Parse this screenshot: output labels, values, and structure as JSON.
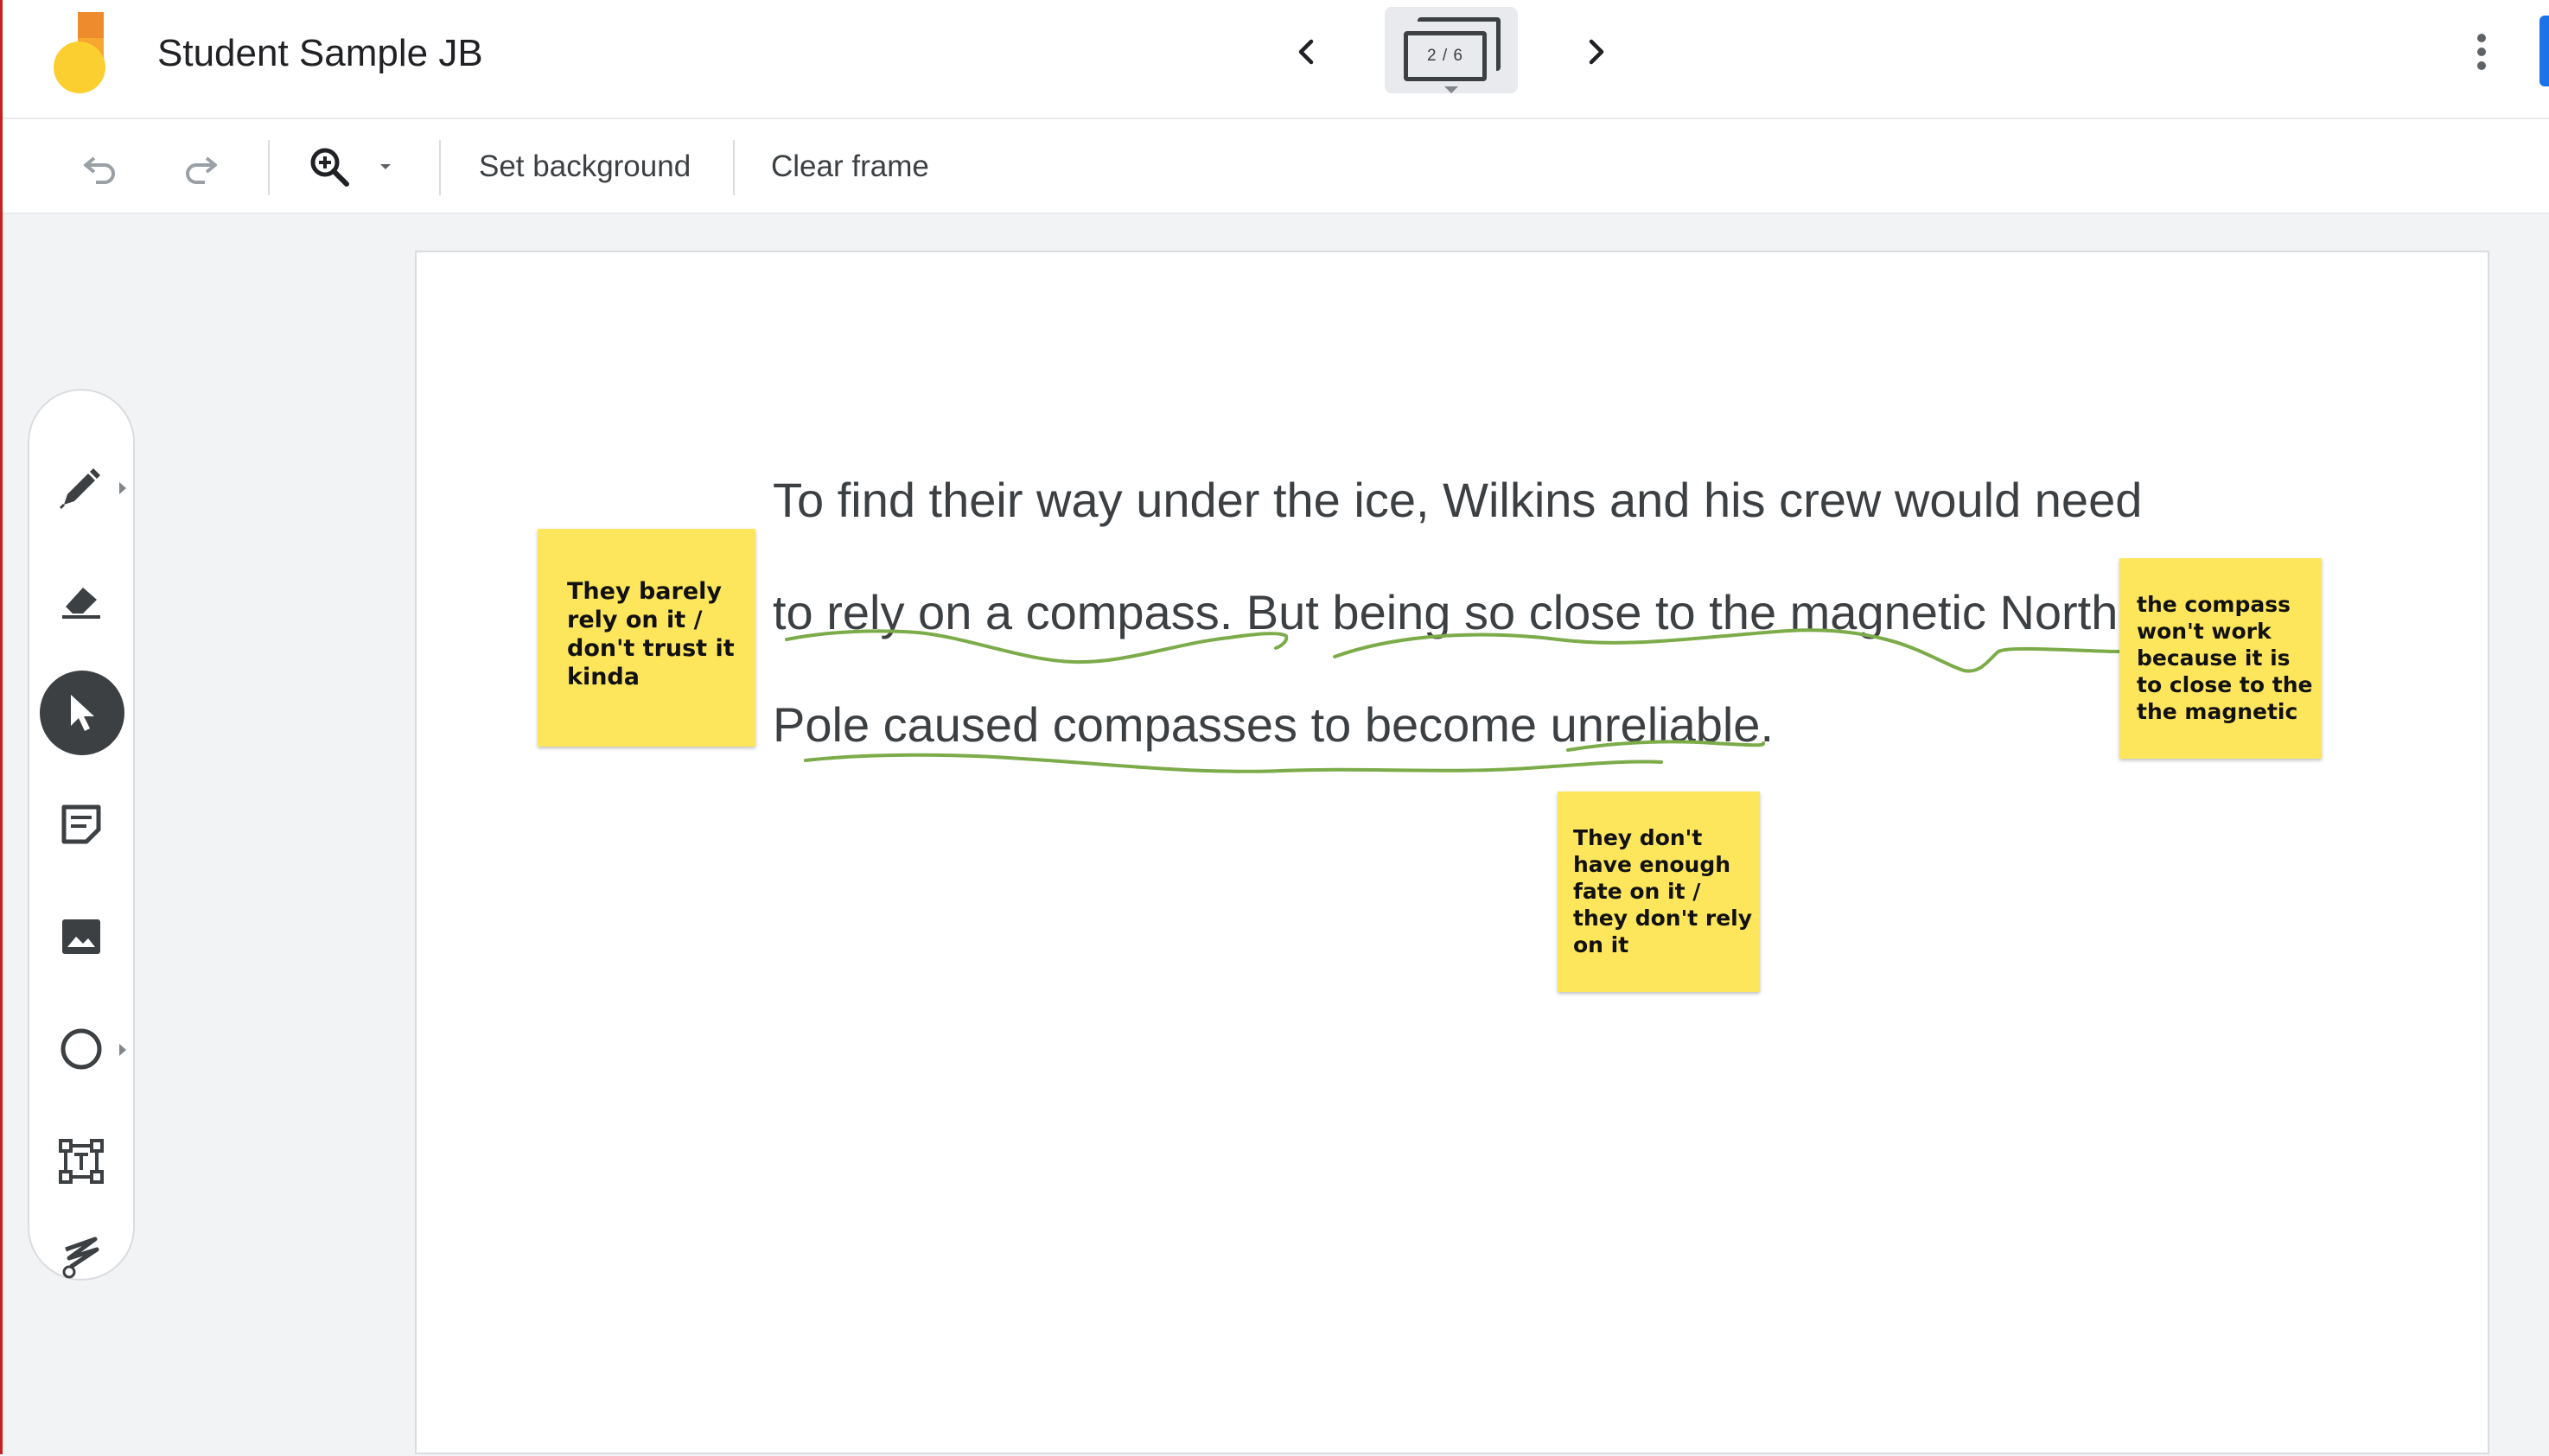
{
  "app": {
    "title": "Student Sample JB",
    "frame_counter": "2 / 6",
    "logo_icon": "jamboard-logo-icon",
    "accent_color": "#1a73e8"
  },
  "navigation": {
    "prev_icon": "chevron-left-icon",
    "next_icon": "chevron-right-icon",
    "more_icon": "more-vert-icon"
  },
  "toolbar": {
    "undo_icon": "undo-icon",
    "redo_icon": "redo-icon",
    "zoom_icon": "zoom-in-icon",
    "zoom_dropdown_icon": "arrow-drop-down-icon",
    "set_background_label": "Set background",
    "clear_frame_label": "Clear frame"
  },
  "tools": [
    {
      "name": "Pen",
      "icon": "pen-icon"
    },
    {
      "name": "Eraser",
      "icon": "eraser-icon"
    },
    {
      "name": "Select",
      "icon": "cursor-icon",
      "active": true
    },
    {
      "name": "Sticky note",
      "icon": "sticky-note-icon"
    },
    {
      "name": "Add image",
      "icon": "image-icon"
    },
    {
      "name": "Circle",
      "icon": "circle-icon"
    },
    {
      "name": "Text box",
      "icon": "text-box-icon"
    },
    {
      "name": "Laser",
      "icon": "laser-icon"
    }
  ],
  "canvas": {
    "text_lines": [
      "To find their way under the ice, Wilkins and his crew would need",
      "to rely on a compass. But being so close to the magnetic North",
      "Pole caused compasses to become unreliable."
    ],
    "ink_color": "#7cab4a",
    "sticky_color": "#fde65c",
    "sticky_notes": [
      {
        "lines": [
          "They barely",
          "rely on it /",
          "don't trust it",
          "kinda"
        ]
      },
      {
        "lines": [
          "the compass",
          "won't work",
          "because it is",
          "to close to the",
          "the magnetic"
        ]
      },
      {
        "lines": [
          "They don't",
          "have enough",
          "fate on it /",
          "they don't rely",
          "on it"
        ]
      }
    ]
  }
}
